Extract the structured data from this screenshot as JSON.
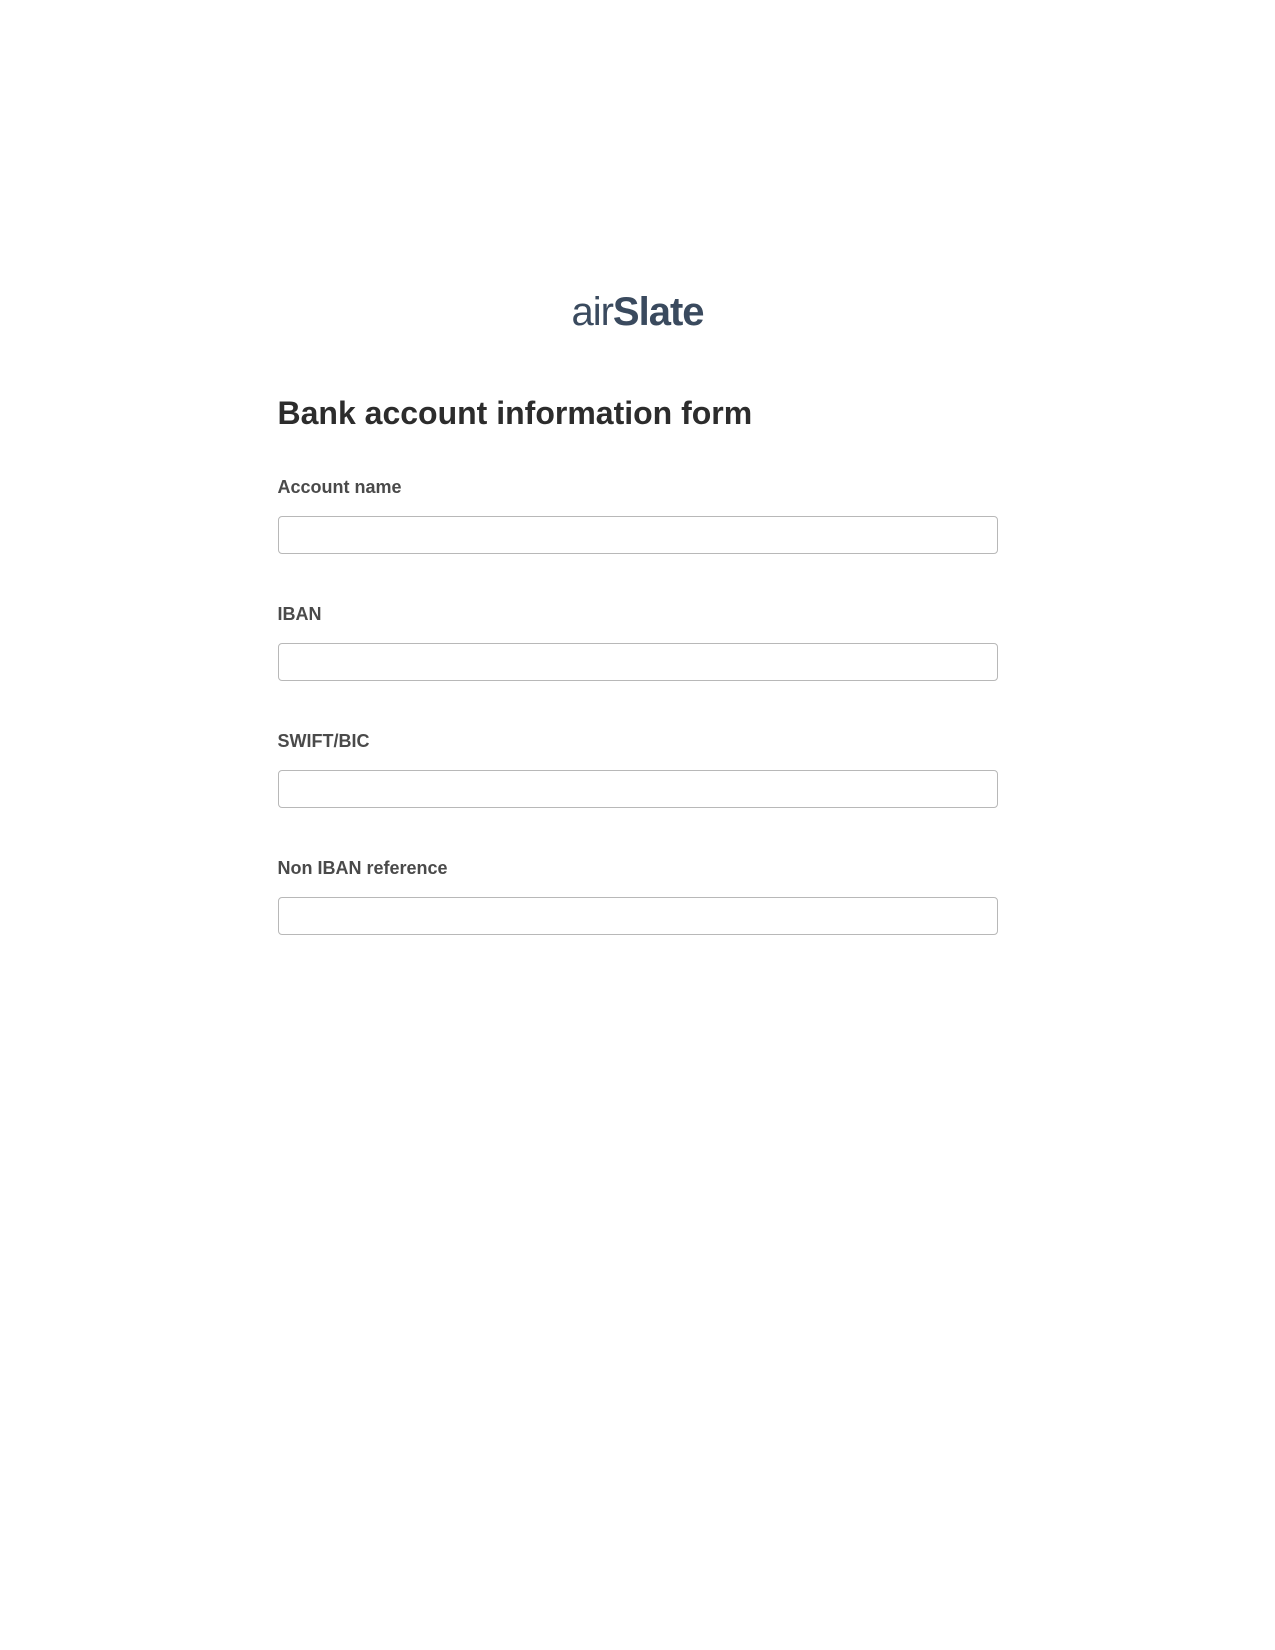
{
  "logo": {
    "prefix": "air",
    "suffix": "Slate"
  },
  "form": {
    "title": "Bank account information form",
    "fields": [
      {
        "label": "Account name",
        "value": ""
      },
      {
        "label": "IBAN",
        "value": ""
      },
      {
        "label": "SWIFT/BIC",
        "value": ""
      },
      {
        "label": "Non IBAN reference",
        "value": ""
      }
    ]
  }
}
